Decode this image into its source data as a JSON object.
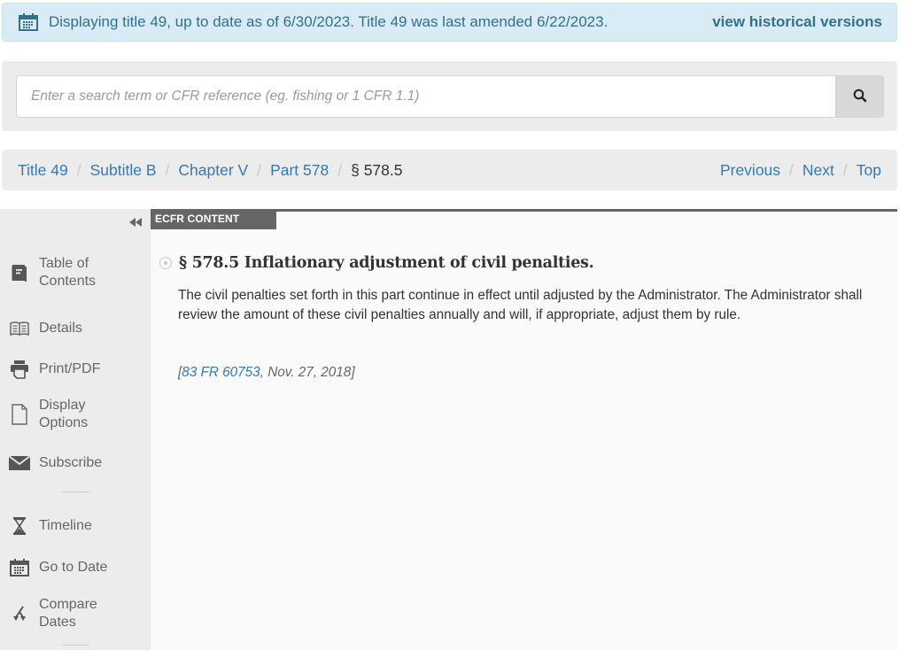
{
  "alert": {
    "icon": "calendar-icon",
    "message": "Displaying title 49, up to date as of 6/30/2023. Title 49 was last amended 6/22/2023.",
    "link_label": "view historical versions"
  },
  "search": {
    "placeholder": "Enter a search term or CFR reference (eg. fishing or 1 CFR 1.1)",
    "value": "",
    "button_icon": "search-icon"
  },
  "breadcrumb": {
    "items": [
      {
        "label": "Title 49",
        "link": true
      },
      {
        "label": "Subtitle B",
        "link": true
      },
      {
        "label": "Chapter V",
        "link": true
      },
      {
        "label": "Part 578",
        "link": true
      },
      {
        "label": "§ 578.5",
        "link": false
      }
    ],
    "separator": "/"
  },
  "pager": {
    "previous": "Previous",
    "next": "Next",
    "top": "Top"
  },
  "sidebar": {
    "collapse_icon": "double-chevron-left-icon",
    "items": [
      {
        "label": "Table of\nContents",
        "icon": "book-icon"
      },
      {
        "label": "Details",
        "icon": "open-book-icon"
      },
      {
        "label": "Print/PDF",
        "icon": "printer-icon"
      },
      {
        "label": "Display\nOptions",
        "icon": "document-icon"
      },
      {
        "label": "Subscribe",
        "icon": "envelope-icon"
      },
      {
        "label": "Timeline",
        "icon": "hourglass-icon"
      },
      {
        "label": "Go to Date",
        "icon": "calendar-icon"
      },
      {
        "label": "Compare\nDates",
        "icon": "compare-arrows-icon"
      }
    ]
  },
  "content": {
    "tab_label": "ECFR CONTENT",
    "section_title": "§ 578.5 Inflationary adjustment of civil penalties.",
    "paragraph": "The civil penalties set forth in this part continue in effect until adjusted by the Administrator. The Administrator shall review the amount of these civil penalties annually and will, if appropriate, adjust them by rule.",
    "citation": {
      "open": "[",
      "link_label": "83 FR 60753",
      "rest": ", Nov. 27, 2018]"
    }
  },
  "colors": {
    "alert_bg": "#d9ecf5",
    "alert_text": "#31708f",
    "link": "#337ab7",
    "tab_bg": "#666666"
  }
}
